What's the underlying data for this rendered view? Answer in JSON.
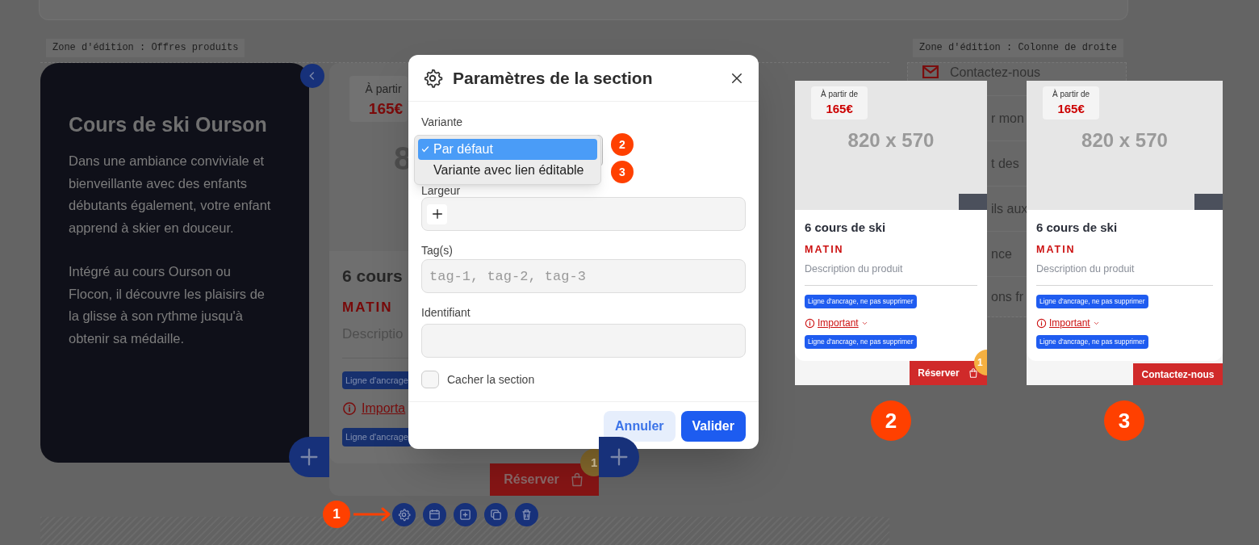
{
  "left_zone": {
    "label": "Zone d'édition : Offres produits",
    "intro_card": {
      "title": "Cours de ski Ourson",
      "paragraphs": [
        "Dans une ambiance conviviale et bienveillante avec des enfants débutants également, votre enfant apprend à skier en douceur.",
        "Intégré au cours Ourson ou Flocon, il découvre les plaisirs de la glisse à son rythme jusqu'à obtenir sa médaille."
      ]
    },
    "product_card": {
      "price_caption": "À partir",
      "price": "165€",
      "image_text": "8",
      "title": "6 cours",
      "subtitle": "MATIN",
      "description": "Descriptio",
      "anchor_tags": [
        "Ligne d'ancrage",
        "Ligne d'ancrage"
      ],
      "important_link": "Importa",
      "button": "Réserver",
      "badge": "1"
    },
    "toolbar_marker": "1"
  },
  "right_zone": {
    "label": "Zone d'édition : Colonne de droite",
    "menu": [
      "Contactez-nous",
      "r mon",
      "t des",
      "ils aux",
      "nce",
      "ons fr"
    ]
  },
  "dialog": {
    "title": "Paramètres de la section",
    "fields": [
      {
        "kind": "select",
        "label": "Variante",
        "options": [
          {
            "label": "Par défaut",
            "selected": true,
            "marker": "2"
          },
          {
            "label": "Variante avec lien éditable",
            "selected": false,
            "marker": "3"
          }
        ]
      },
      {
        "kind": "add",
        "label": "Largeur"
      },
      {
        "kind": "text",
        "label": "Tag(s)",
        "placeholder": "tag-1, tag-2, tag-3"
      },
      {
        "kind": "text",
        "label": "Identifiant"
      },
      {
        "kind": "checkbox",
        "label": "Cacher la section",
        "checked": false
      }
    ],
    "buttons": [
      {
        "label": "Annuler",
        "kind": "secondary"
      },
      {
        "label": "Valider",
        "kind": "primary"
      }
    ]
  },
  "previews": [
    {
      "marker": "2",
      "price_caption": "À partir de",
      "price": "165€",
      "image_text": "820 x 570",
      "title": "6 cours de ski",
      "subtitle": "MATIN",
      "description": "Description du produit",
      "anchor_tags": [
        "Ligne d'ancrage, ne pas supprimer",
        "Ligne d'ancrage, ne pas supprimer"
      ],
      "important_link": "Important",
      "button": {
        "kind": "cart",
        "label": "Réserver",
        "badge": "1"
      }
    },
    {
      "marker": "3",
      "price_caption": "À partir de",
      "price": "165€",
      "image_text": "820 x 570",
      "title": "6 cours de ski",
      "subtitle": "MATIN",
      "description": "Description du produit",
      "anchor_tags": [
        "Ligne d'ancrage, ne pas supprimer",
        "Ligne d'ancrage, ne pas supprimer"
      ],
      "important_link": "Important",
      "button": {
        "kind": "plain",
        "label": "Contactez-nous"
      }
    }
  ]
}
